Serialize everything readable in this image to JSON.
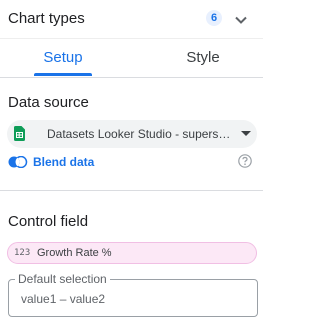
{
  "header": {
    "title": "Chart types",
    "badge_count": "6",
    "chevron_icon": "chevron-down-icon"
  },
  "tabs": [
    {
      "label": "Setup",
      "active": true
    },
    {
      "label": "Style",
      "active": false
    }
  ],
  "data_source": {
    "section_title": "Data source",
    "source_icon": "google-sheets-icon",
    "source_name": "Datasets Looker Studio - superstore",
    "blend_label": "Blend data",
    "blend_icon": "blend-icon",
    "help_icon": "help-circle-icon"
  },
  "control_field": {
    "section_title": "Control field",
    "field_type": "123",
    "field_name": "Growth Rate %",
    "default_selection_label": "Default selection",
    "default_selection_value": "value1 – value2"
  },
  "colors": {
    "accent": "#1a73e8",
    "chip_bg": "#fce8f6",
    "sheets_green": "#0f9d58"
  }
}
